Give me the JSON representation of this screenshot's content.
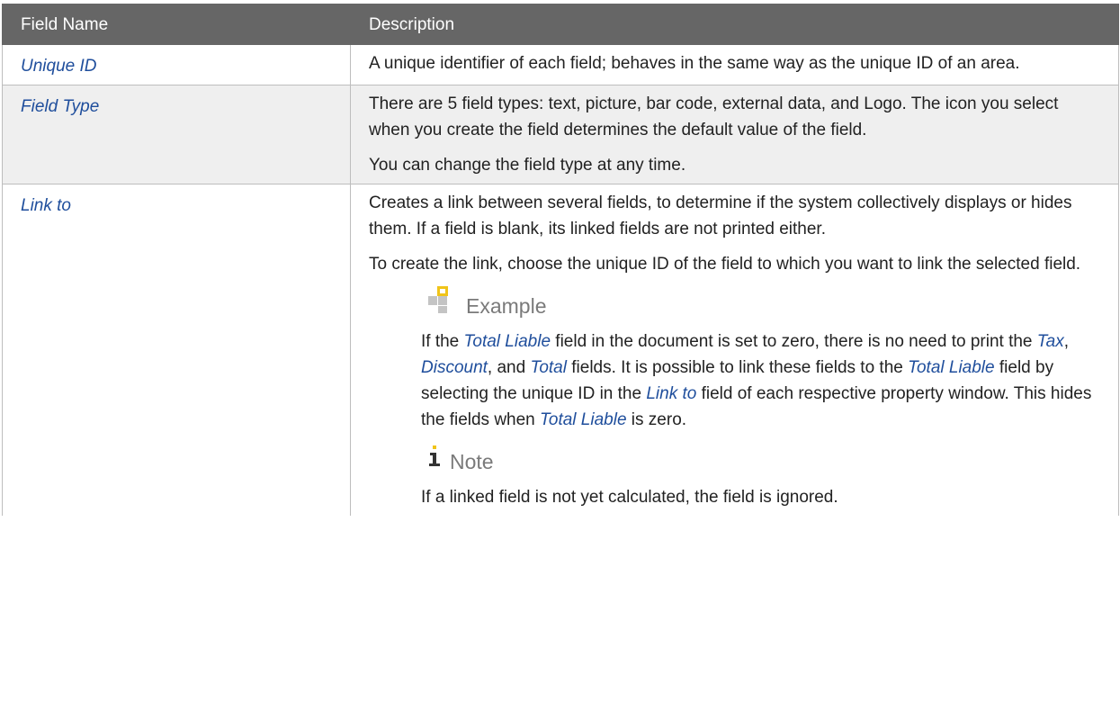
{
  "table": {
    "headers": [
      "Field Name",
      "Description"
    ],
    "rows": {
      "unique_id": {
        "name": "Unique ID",
        "desc": "A unique identifier of each field; behaves in the same way as the unique ID of an area."
      },
      "field_type": {
        "name": "Field Type",
        "desc1": "There are 5 field types: text, picture, bar code, external data, and Logo. The icon you select when you create the field determines the default value of the field.",
        "desc2": "You can change the field type at any time."
      },
      "link_to": {
        "name": "Link to",
        "desc1": "Creates a link between several fields, to determine if the system collectively displays or hides them. If a field is blank, its linked fields are not printed either.",
        "desc2": "To create the link, choose the unique ID of the field to which you want to link the selected field.",
        "example": {
          "title": "Example",
          "icon": "example-puzzle-icon",
          "t1": "If the ",
          "r1": "Total Liable",
          "t2": " field in the document is set to zero, there is no need to print the ",
          "r2": "Tax",
          "t3": ", ",
          "r3": "Discount",
          "t4": ", and ",
          "r4": "Total",
          "t5": " fields. It is possible to link these fields to the ",
          "r5": "Total Liable",
          "t6": " field by selecting the unique ID in the ",
          "r6": "Link to",
          "t7": " field of each respective property window. This hides the fields when ",
          "r7": "Total Liable",
          "t8": " is zero."
        },
        "note": {
          "title": "Note",
          "icon": "info-note-icon",
          "text": "If a linked field is not yet calculated, the field is ignored."
        }
      }
    }
  },
  "colors": {
    "header_bg": "#666666",
    "row_shade": "#efefef",
    "link_blue": "#1f4e9c",
    "border": "#bdbdbd"
  }
}
